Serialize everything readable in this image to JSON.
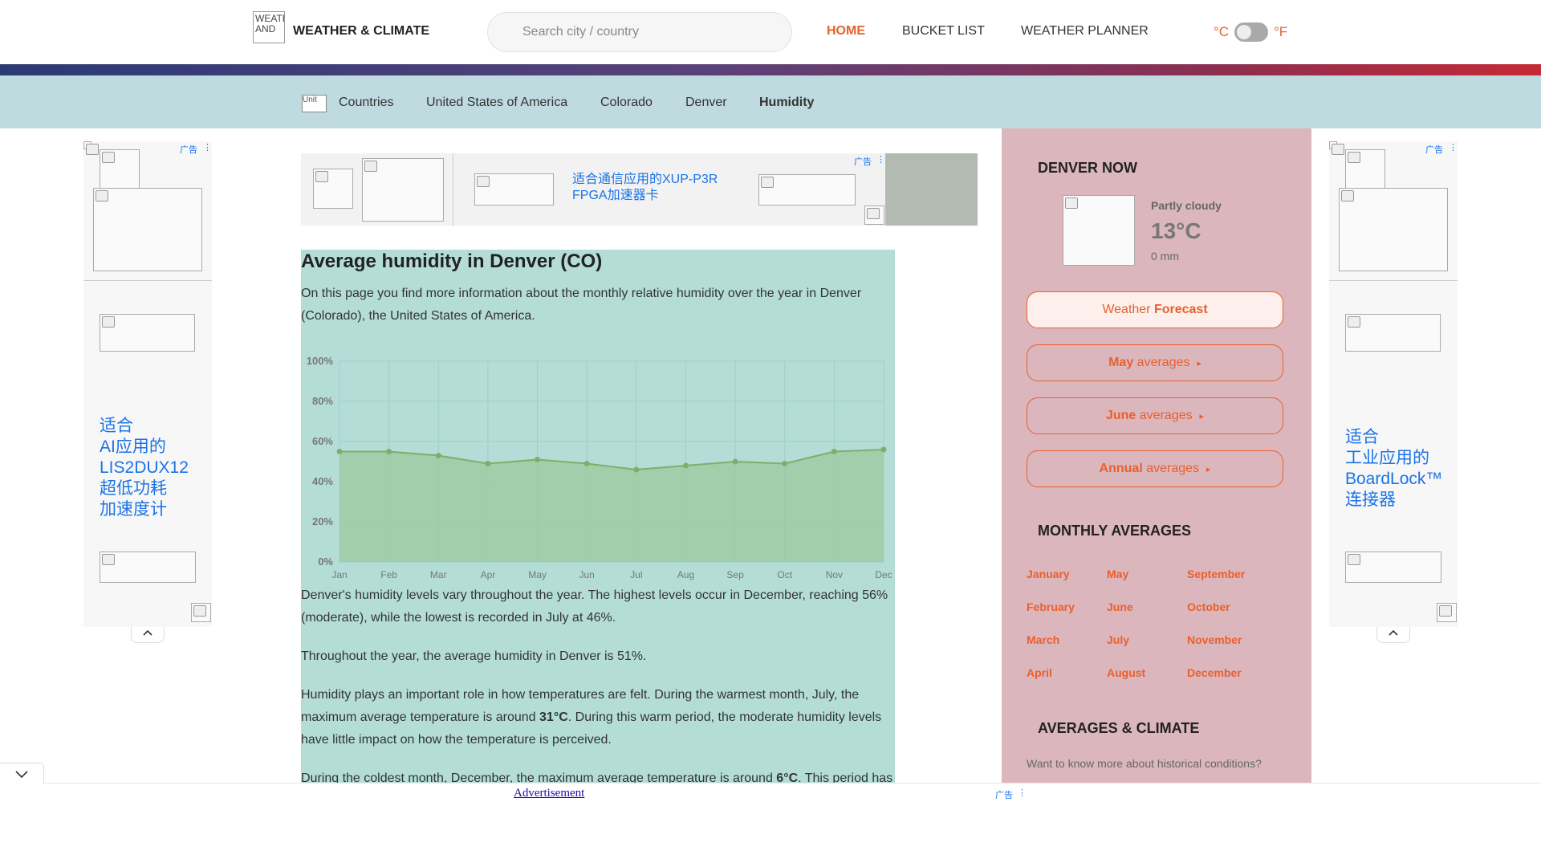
{
  "header": {
    "logo_alt": "WEATHER AND",
    "site_title": "WEATHER & CLIMATE",
    "search_placeholder": "Search city / country",
    "nav": [
      "HOME",
      "BUCKET LIST",
      "WEATHER PLANNER"
    ],
    "unit_c": "°C",
    "unit_f": "°F"
  },
  "breadcrumb": {
    "icon_alt": "Unit",
    "items": [
      "Countries",
      "United States of America",
      "Colorado",
      "Denver",
      "Humidity"
    ]
  },
  "ads": {
    "label": "广告",
    "left_text": [
      "适合",
      "AI应用的",
      "LIS2DUX12",
      "超低功耗",
      "加速度计"
    ],
    "right_text": [
      "适合",
      "工业应用的",
      "BoardLock™",
      "连接器"
    ],
    "top_text": "适合通信应用的XUP-P3R FPGA加速器卡",
    "bottom_text": "Advertisement"
  },
  "main": {
    "title": "Average humidity in Denver (CO)",
    "intro": "On this page you find more information about the monthly relative humidity over the year in Denver (Colorado), the United States of America.",
    "p1": "Denver's humidity levels vary throughout the year. The highest levels occur in December, reaching 56% (moderate), while the lowest is recorded in July at 46%.",
    "p2": "Throughout the year, the average humidity in Denver is 51%.",
    "p3a": "Humidity plays an important role in how temperatures are felt. During the warmest month, July, the maximum average temperature is around ",
    "p3b": "31°C",
    "p3c": ". During this warm period, the moderate humidity levels have little impact on how the temperature is perceived.",
    "p4a": "During the coldest month, December, the maximum average temperature is around ",
    "p4b": "6°C",
    "p4c": ". This period has"
  },
  "chart_data": {
    "type": "area",
    "categories": [
      "Jan",
      "Feb",
      "Mar",
      "Apr",
      "May",
      "Jun",
      "Jul",
      "Aug",
      "Sep",
      "Oct",
      "Nov",
      "Dec"
    ],
    "values": [
      55,
      55,
      53,
      49,
      51,
      49,
      46,
      48,
      50,
      49,
      55,
      56
    ],
    "ylim": [
      0,
      100
    ],
    "yticks": [
      "0%",
      "20%",
      "40%",
      "60%",
      "80%",
      "100%"
    ],
    "grid": true,
    "line_color": "#7daf6c",
    "fill_color": "#9dcba3"
  },
  "sidebar": {
    "now_title": "DENVER NOW",
    "condition": "Partly cloudy",
    "temp": "13°C",
    "precip": "0 mm",
    "btn_weather_a": "Weather ",
    "btn_weather_b": "Forecast",
    "btn_may_a": "May",
    "btn_may_b": " averages",
    "btn_june_a": "June",
    "btn_june_b": " averages",
    "btn_annual_a": "Annual",
    "btn_annual_b": " averages",
    "arrow": "▸",
    "monthly_title": "MONTHLY AVERAGES",
    "months": [
      "January",
      "February",
      "March",
      "April",
      "May",
      "June",
      "July",
      "August",
      "September",
      "October",
      "November",
      "December"
    ],
    "climate_title": "AVERAGES & CLIMATE",
    "climate_text": "Want to know more about historical conditions?"
  },
  "colors": {
    "accent": "#e8602c",
    "content_bg": "#b4ddd8",
    "sidebar_bg": "#dcb6bd",
    "breadcrumb_bg": "#c0dbe0"
  }
}
